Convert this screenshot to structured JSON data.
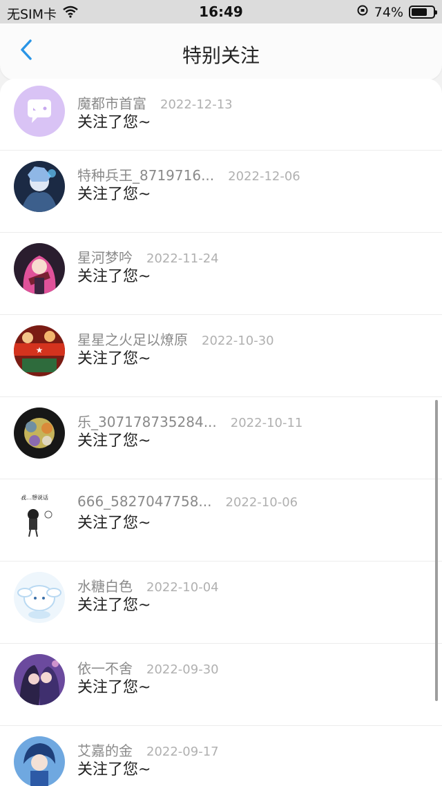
{
  "status_bar": {
    "carrier": "无SIM卡",
    "time": "16:49",
    "battery_text": "74%",
    "battery_level": 0.74
  },
  "nav": {
    "title": "特别关注"
  },
  "items": [
    {
      "name": "魔都市首富",
      "date": "2022-12-13",
      "message": "关注了您~",
      "avatar": "default-chat-avatar"
    },
    {
      "name": "特种兵王_8719716...",
      "date": "2022-12-06",
      "message": "关注了您~",
      "avatar": "anime-dark-avatar"
    },
    {
      "name": "星河梦吟",
      "date": "2022-11-24",
      "message": "关注了您~",
      "avatar": "anime-pink-hair-avatar"
    },
    {
      "name": "星星之火足以燎原",
      "date": "2022-10-30",
      "message": "关注了您~",
      "avatar": "game-poster-avatar"
    },
    {
      "name": "乐_307178735284...",
      "date": "2022-10-11",
      "message": "关注了您~",
      "avatar": "collage-avatar"
    },
    {
      "name": "666_5827047758...",
      "date": "2022-10-06",
      "message": "关注了您~",
      "avatar": "sketch-avatar"
    },
    {
      "name": "水糖白色",
      "date": "2022-10-04",
      "message": "关注了您~",
      "avatar": "cinnamoroll-avatar"
    },
    {
      "name": "依一不舍",
      "date": "2022-09-30",
      "message": "关注了您~",
      "avatar": "anime-couple-avatar"
    },
    {
      "name": "艾嘉的金",
      "date": "2022-09-17",
      "message": "关注了您~",
      "avatar": "anime-blue-avatar"
    }
  ]
}
